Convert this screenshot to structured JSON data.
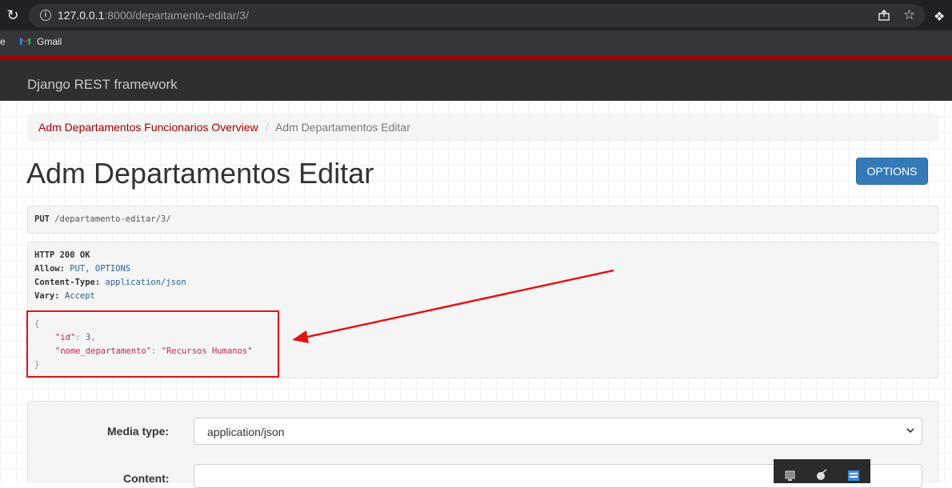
{
  "browser": {
    "url_host": "127.0.0.1",
    "url_rest": ":8000/departamento-editar/3/",
    "bookmark_partial": "e",
    "bookmark_gmail": "Gmail"
  },
  "navbar": {
    "brand": "Django REST framework"
  },
  "breadcrumb": {
    "link": "Adm Departamentos Funcionarios Overview",
    "separator": "/",
    "active": "Adm Departamentos Editar"
  },
  "page": {
    "title": "Adm Departamentos Editar",
    "options_label": "OPTIONS"
  },
  "request": {
    "method": "PUT",
    "path": "/departamento-editar/3/"
  },
  "response": {
    "status": "HTTP 200 OK",
    "headers": [
      {
        "key": "Allow:",
        "value": "PUT, OPTIONS"
      },
      {
        "key": "Content-Type:",
        "value": "application/json"
      },
      {
        "key": "Vary:",
        "value": "Accept"
      }
    ],
    "json": {
      "open": "{",
      "close": "}",
      "id_key": "\"id\"",
      "id_value": "3",
      "nome_key": "\"nome_departamento\"",
      "nome_value": "\"Recursos Humanos\""
    }
  },
  "form": {
    "media_type_label": "Media type:",
    "media_type_value": "application/json",
    "content_label": "Content:"
  },
  "colors": {
    "navbar_accent": "#a30000",
    "link": "#a30000",
    "options_button": "#337ab7",
    "annotation": "#e21414"
  }
}
